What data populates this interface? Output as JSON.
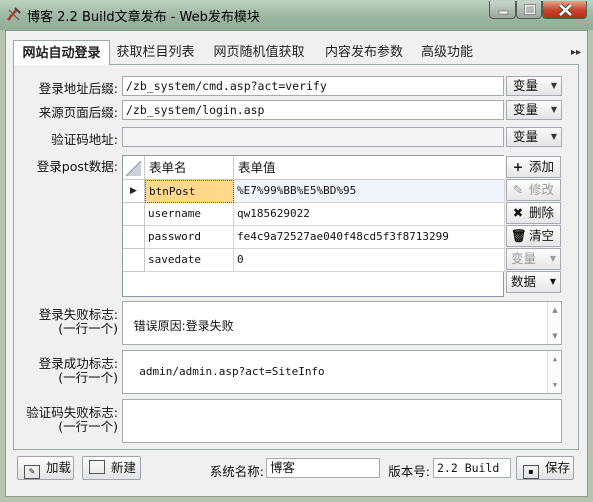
{
  "window": {
    "title": "博客 2.2 Build文章发布 - Web发布模块"
  },
  "tabs": [
    {
      "label": "网站自动登录",
      "active": true
    },
    {
      "label": "获取栏目列表"
    },
    {
      "label": "网页随机值获取"
    },
    {
      "label": "内容发布参数"
    },
    {
      "label": "高级功能"
    }
  ],
  "tab_scroll_glyph": "▸▸",
  "form": {
    "login_url": {
      "label": "登录地址后缀:",
      "value": "/zb_system/cmd.asp?act=verify",
      "combo": "变量"
    },
    "referer": {
      "label": "来源页面后缀:",
      "value": "/zb_system/login.asp",
      "combo": "变量"
    },
    "captcha_url": {
      "label": "验证码地址:",
      "value": "",
      "combo": "变量"
    },
    "post_label": "登录post数据:",
    "grid": {
      "columns": [
        "表单名",
        "表单值"
      ],
      "rows": [
        {
          "name": "btnPost",
          "value": "%E7%99%BB%E5%BD%95",
          "selected": true
        },
        {
          "name": "username",
          "value": "qw185629022"
        },
        {
          "name": "password",
          "value": "fe4c9a72527ae040f48cd5f3f8713299"
        },
        {
          "name": "savedate",
          "value": "0"
        }
      ]
    },
    "side_buttons": {
      "add": "添加",
      "edit": "修改",
      "delete": "删除",
      "clear": "清空",
      "variable": "变量",
      "data": "数据"
    },
    "fail_flag": {
      "label1": "登录失败标志:",
      "label2": "(一行一个)",
      "value": "错误原因:登录失败"
    },
    "success_flag": {
      "label1": "登录成功标志:",
      "label2": "(一行一个)",
      "value": "admin/admin.asp?act=SiteInfo"
    },
    "captcha_fail": {
      "label1": "验证码失败标志:",
      "label2": "(一行一个)",
      "value": ""
    }
  },
  "footer": {
    "load_button": "加载",
    "new_button": "新建",
    "system_name_label": "系统名称:",
    "system_name_value": "博客",
    "version_label": "版本号:",
    "version_value": "2.2 Build",
    "save_button": "保存"
  },
  "colors": {
    "titlebar": "#9fb8a3",
    "close_button": "#c7402a",
    "selected_cell": "#ffd88a"
  }
}
